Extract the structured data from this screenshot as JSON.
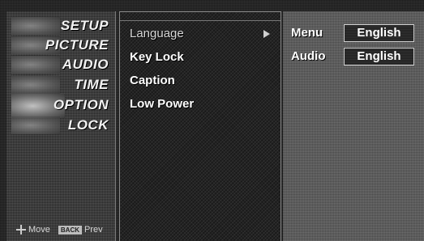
{
  "sidebar": {
    "items": [
      {
        "label": "SETUP"
      },
      {
        "label": "PICTURE"
      },
      {
        "label": "AUDIO"
      },
      {
        "label": "TIME"
      },
      {
        "label": "OPTION"
      },
      {
        "label": "LOCK"
      }
    ],
    "selected": "OPTION",
    "footer": {
      "move_icon": "four-way-arrow-icon",
      "move_label": "Move",
      "back_key_label": "BACK",
      "prev_label": "Prev"
    }
  },
  "menu": {
    "items": [
      {
        "label": "Language"
      },
      {
        "label": "Key Lock"
      },
      {
        "label": "Caption"
      },
      {
        "label": "Low Power"
      }
    ],
    "selected": "Language",
    "submenu_arrow_icon": "right-arrow-icon"
  },
  "options": [
    {
      "label": "Menu",
      "value": "English"
    },
    {
      "label": "Audio",
      "value": "English"
    }
  ]
}
